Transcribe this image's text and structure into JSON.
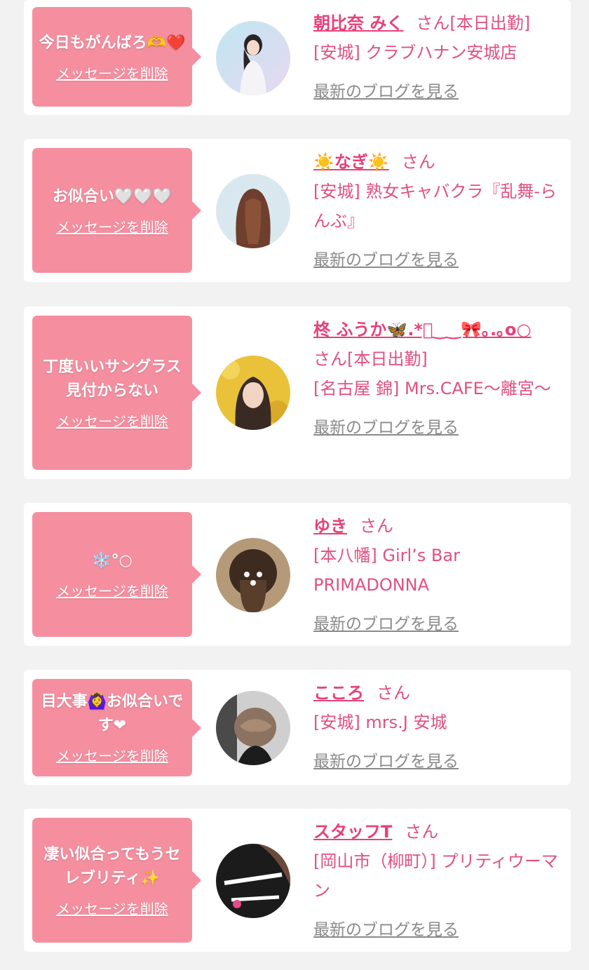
{
  "delete_label": "メッセージを削除",
  "blog_label": "最新のブログを見る",
  "san_suffix": "さん",
  "colors": {
    "background": "#f2f2f2",
    "bubble": "#f58fa0",
    "name": "#e8407a",
    "shop": "#e05081",
    "blog_link": "#8a8a8a"
  },
  "cards": [
    {
      "message": "今日もがんばろ🫶❤️",
      "name": "朝比奈 みく",
      "status": "[本日出勤]",
      "shop": "[安城] クラブハナン安城店",
      "avatar_icon": "woman-photo-icon"
    },
    {
      "message": "お似合い🤍🤍🤍",
      "name": "☀️なぎ☀️",
      "status": "",
      "shop": "[安城] 熟女キャバクラ『乱舞-らんぶ』",
      "avatar_icon": "hair-photo-icon"
    },
    {
      "message": "丁度いいサングラス見付からない",
      "name": "柊 ふうか🦋.*ﾟ‿‿🎀｡.｡o○",
      "status": "[本日出勤]",
      "shop": "[名古屋 錦] Mrs.CAFE〜離宮〜",
      "avatar_icon": "woman-photo-icon"
    },
    {
      "message": "❄️°○",
      "name": "ゆき",
      "status": "",
      "shop": "[本八幡] Girl’s Bar PRIMADONNA",
      "avatar_icon": "hair-photo-icon"
    },
    {
      "message": "目大事🙆‍♀️お似合いです❤︎",
      "name": "こころ",
      "status": "",
      "shop": "[安城] mrs.J 安城",
      "avatar_icon": "hair-photo-icon"
    },
    {
      "message": "凄い似合ってもうセレブリティ✨",
      "name": "スタッフT",
      "status": "",
      "shop": "[岡山市（柳町）] プリティウーマン",
      "avatar_icon": "shop-logo-icon"
    }
  ]
}
